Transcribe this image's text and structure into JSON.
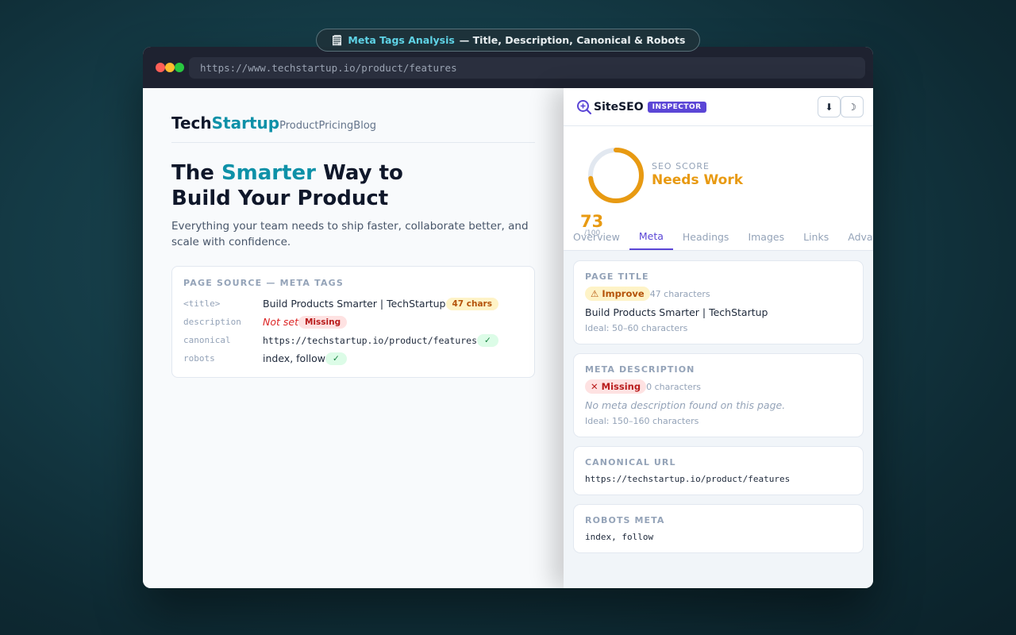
{
  "banner": {
    "icon": "clipboard-icon",
    "glyph": "🗒",
    "accent": "Meta Tags Analysis",
    "rest": "— Title, Description, Canonical & Robots"
  },
  "browser": {
    "url": "https://www.techstartup.io/product/features"
  },
  "site": {
    "logo_a": "Tech",
    "logo_b": "Startup",
    "nav": [
      "Product",
      "Pricing",
      "Blog"
    ],
    "hero_a": "The ",
    "hero_hl": "Smarter",
    "hero_b": " Way to",
    "hero_c": "Build Your Product",
    "subtitle": "Everything your team needs to ship faster, collaborate better, and scale with confidence.",
    "source": {
      "title": "PAGE SOURCE — META TAGS",
      "rows": [
        {
          "key": "<title>",
          "value": "Build Products Smarter | TechStartup",
          "chip": "47 chars"
        },
        {
          "key": "description",
          "value": "Not set",
          "chip": "Missing"
        },
        {
          "key": "canonical",
          "value": "https://techstartup.io/product/features",
          "chip": "✓"
        },
        {
          "key": "robots",
          "value": "index, follow",
          "chip": "✓"
        }
      ]
    }
  },
  "panel": {
    "brand": "SiteSEO",
    "badge": "INSPECTOR",
    "btn_download": "⬇",
    "btn_theme": "☽",
    "score": {
      "value": "73",
      "of": "/100",
      "fraction": 0.73,
      "label": "SEO SCORE",
      "status": "Needs Work",
      "color": "#e89a12"
    },
    "tabs": [
      "Overview",
      "Meta",
      "Headings",
      "Images",
      "Links",
      "Advanced"
    ],
    "active_tab": "Meta",
    "cards": {
      "title": {
        "heading": "PAGE TITLE",
        "tag": "⚠ Improve",
        "count": "47 characters",
        "value": "Build Products Smarter | TechStartup",
        "ideal": "Ideal: 50–60 characters"
      },
      "description": {
        "heading": "META DESCRIPTION",
        "tag": "✕ Missing",
        "count": "0 characters",
        "value": "No meta description found on this page.",
        "ideal": "Ideal: 150–160 characters"
      },
      "canonical": {
        "heading": "CANONICAL URL",
        "value": "https://techstartup.io/product/features"
      },
      "robots": {
        "heading": "ROBOTS META",
        "value": "index, follow"
      }
    }
  }
}
